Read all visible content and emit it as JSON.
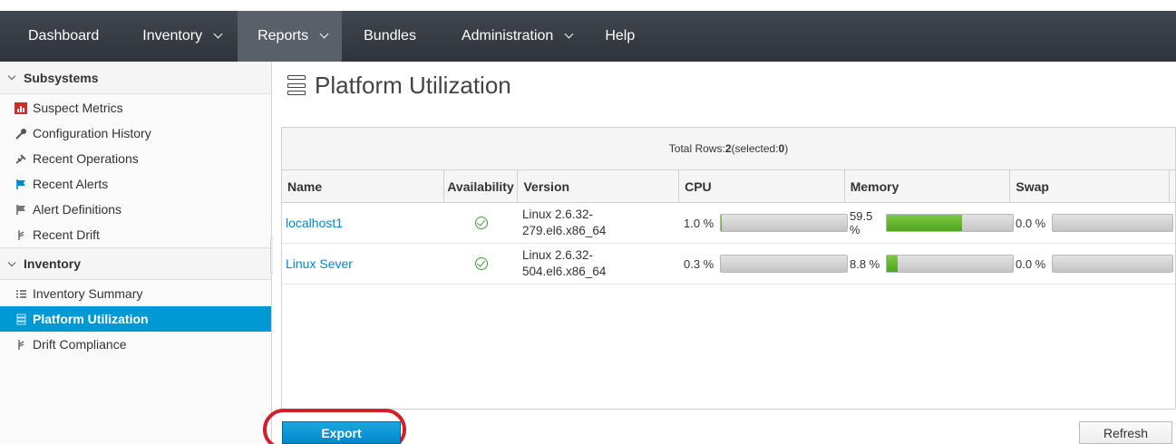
{
  "nav": {
    "items": [
      {
        "label": "Dashboard",
        "dropdown": false,
        "active": false
      },
      {
        "label": "Inventory",
        "dropdown": true,
        "active": false
      },
      {
        "label": "Reports",
        "dropdown": true,
        "active": true
      },
      {
        "label": "Bundles",
        "dropdown": false,
        "active": false
      },
      {
        "label": "Administration",
        "dropdown": true,
        "active": false
      },
      {
        "label": "Help",
        "dropdown": false,
        "active": false
      }
    ]
  },
  "sidebar": {
    "subsystems_label": "Subsystems",
    "subsystems": [
      {
        "label": "Suspect Metrics",
        "icon": "suspect-metrics-icon"
      },
      {
        "label": "Configuration History",
        "icon": "wrench-icon"
      },
      {
        "label": "Recent Operations",
        "icon": "operations-icon"
      },
      {
        "label": "Recent Alerts",
        "icon": "flag-icon"
      },
      {
        "label": "Alert Definitions",
        "icon": "flag-outline-icon"
      },
      {
        "label": "Recent Drift",
        "icon": "drift-icon"
      }
    ],
    "inventory_label": "Inventory",
    "inventory": [
      {
        "label": "Inventory Summary",
        "icon": "list-icon"
      },
      {
        "label": "Platform Utilization",
        "icon": "server-icon"
      },
      {
        "label": "Drift Compliance",
        "icon": "drift-icon"
      }
    ]
  },
  "main": {
    "title": "Platform Utilization",
    "totals_prefix": "Total Rows: ",
    "total_rows": "2",
    "selected_prefix": " (selected: ",
    "selected": "0",
    "selected_suffix": ")",
    "columns": [
      "Name",
      "Availability",
      "Version",
      "CPU",
      "Memory",
      "Swap"
    ],
    "rows": [
      {
        "name": "localhost1",
        "availability": "up",
        "version_line1": "Linux 2.6.32-",
        "version_line2": "279.el6.x86_64",
        "cpu_label": "1.0 %",
        "cpu": 1.0,
        "memory_label": "59.5 %",
        "memory": 59.5,
        "swap_label": "0.0 %",
        "swap": 0.0
      },
      {
        "name": "Linux Sever",
        "availability": "up",
        "version_line1": "Linux 2.6.32-",
        "version_line2": "504.el6.x86_64",
        "cpu_label": "0.3 %",
        "cpu": 0.3,
        "memory_label": "8.8 %",
        "memory": 8.8,
        "swap_label": "0.0 %",
        "swap": 0.0
      }
    ],
    "export_label": "Export",
    "refresh_label": "Refresh"
  },
  "colors": {
    "accent": "#0099d3",
    "link": "#0088ce",
    "bar_fill": "#5bb12a",
    "highlight": "#d0202a",
    "available": "#3f9c35"
  }
}
